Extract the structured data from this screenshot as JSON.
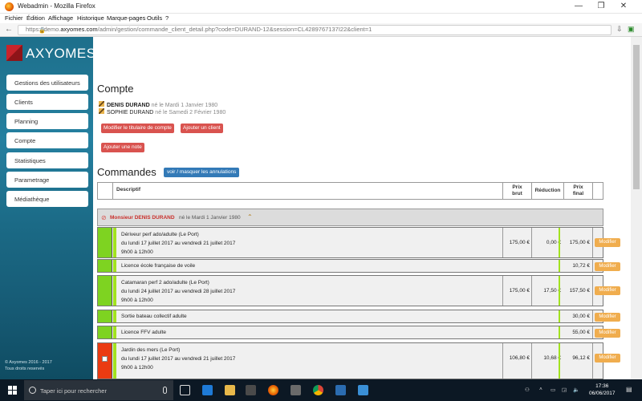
{
  "window": {
    "title": "Webadmin - Mozilla Firefox",
    "min": "—",
    "max": "❐",
    "close": "✕"
  },
  "menu": [
    "Fichier",
    "Édition",
    "Affichage",
    "Historique",
    "Marque-pages",
    "Outils",
    "?"
  ],
  "url": {
    "prefix": "https://demo.",
    "domain": "axyomes.com",
    "rest": "/admin/gestion/commande_client_detail.php?code=DURAND-12&session=CL4289767137I22&client=1"
  },
  "logo_text": "AXYOMES",
  "sidebar": [
    "Gestions des utilisateurs",
    "Clients",
    "Planning",
    "Compte",
    "Statistiques",
    "Parametrage",
    "Médiathèque"
  ],
  "footer": {
    "line1": "© Axyomes 2016 - 2017",
    "line2": "Tous droits reservés"
  },
  "compte": {
    "title": "Compte",
    "holders": [
      {
        "name": "DENIS DURAND",
        "info": "né le Mardi 1 Janvier 1980"
      },
      {
        "name": "SOPHIE DURAND",
        "info": "né le Samedi 2 Février 1980"
      }
    ],
    "btn_modifier_titulaire": "Modifier le titulaire de compte",
    "btn_ajouter_client": "Ajouter un client",
    "btn_ajouter_note": "Ajouter une note"
  },
  "commandes": {
    "title": "Commandes",
    "toggle_btn": "voir / masquer les annulations",
    "headers": {
      "descriptif": "Descriptif",
      "prix_brut_1": "Prix",
      "prix_brut_2": "brut",
      "reduction": "Réduction",
      "prix_final_1": "Prix",
      "prix_final_2": "final"
    },
    "group": {
      "name": "Monsieur DENIS DURAND",
      "info": "né le Mardi 1 Janvier 1980"
    },
    "modifier_label": "Modifier",
    "rows": [
      {
        "l1": "Dériveur perf ado/adulte (Le Port)",
        "l2": "du lundi 17 juillet 2017 au vendredi 21 juillet 2017",
        "l3": "9h00 à 12h00",
        "brut": "175,00 €",
        "red": "0,00 €",
        "final": "175,00 €"
      },
      {
        "l1": "Licence école française de voile",
        "final": "10,72 €"
      },
      {
        "l1": "Catamaran perf 2 ado/adulte (Le Port)",
        "l2": "du lundi 24 juillet 2017 au vendredi 28 juillet 2017",
        "l3": "9h00 à 12h00",
        "brut": "175,00 €",
        "red": "17,50 €",
        "final": "157,50 €"
      },
      {
        "l1": "Sortie bateau collectif adulte",
        "final": "30,00 €"
      },
      {
        "l1": "Licence FFV adulte",
        "final": "55,00 €"
      },
      {
        "l1": "Jardin des mers (Le Port)",
        "l2": "du lundi 17 juillet 2017 au vendredi 21 juillet 2017",
        "l3": "9h00 à 12h00",
        "brut": "106,80 €",
        "red": "10,68 €",
        "final": "96,12 €"
      }
    ]
  },
  "taskbar": {
    "search_placeholder": "Taper ici pour rechercher",
    "time": "17:36",
    "date": "06/06/2017"
  },
  "colors": {
    "sidebar": "#1d6f8b",
    "red_button": "#d9534f",
    "blue_button": "#337ab7",
    "modify_button": "#f0ad4e",
    "status_green": "#7ed321",
    "status_red": "#ea3b12"
  }
}
